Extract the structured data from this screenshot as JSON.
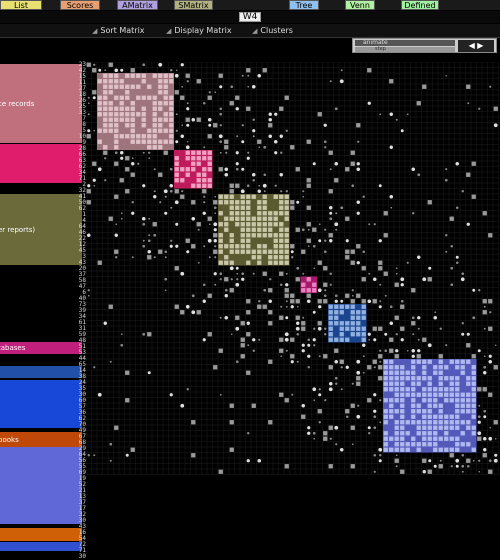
{
  "tabs": [
    {
      "label": "List",
      "color": "#e8e070"
    },
    {
      "label": "Scores",
      "color": "#e8a070"
    },
    {
      "label": "AMatrix",
      "color": "#b0a0e0"
    },
    {
      "label": "SMatrix",
      "color": "#b0b080"
    },
    {
      "label": "Tree",
      "color": "#90c0f0"
    },
    {
      "label": "Venn",
      "color": "#b0f0a0"
    },
    {
      "label": "Defined",
      "color": "#a0f0a0"
    }
  ],
  "window": {
    "title": "W4"
  },
  "menus": [
    "Sort Matrix",
    "Display Matrix",
    "Clusters"
  ],
  "animation": {
    "animate_label": "animate",
    "step_label": "step",
    "play_symbol": "◀ ▶"
  },
  "groups": [
    {
      "label": "ce records",
      "color": "#c0707c"
    },
    {
      "label": "",
      "color": "#e01c6c"
    },
    {
      "label": "er reports)",
      "color": "#6a6a3a"
    },
    {
      "label": "tabases",
      "color": "#c0207c"
    },
    {
      "label": "",
      "color": "#2050a8"
    },
    {
      "label": "",
      "color": "#1848d8"
    },
    {
      "label": "books",
      "color": "#c04808"
    },
    {
      "label": "",
      "color": "#6068d8"
    },
    {
      "label": "",
      "color": "#d06008"
    },
    {
      "label": "",
      "color": "#3050d0"
    }
  ],
  "row_numbers": [
    "23",
    "42",
    "15",
    "11",
    "27",
    "18",
    "26",
    "25",
    "33",
    "7",
    "8",
    "5",
    "10",
    "9",
    "28",
    "66",
    "63",
    "62",
    "34",
    "71",
    "2",
    "32",
    "41",
    "50",
    "62",
    "1",
    "4",
    "64",
    "46",
    "22",
    "12",
    "45",
    "3",
    "43",
    "20",
    "37",
    "58",
    "47",
    "6",
    "40",
    "73",
    "39",
    "34",
    "61",
    "31",
    "59",
    "48",
    "51",
    "53",
    "44",
    "65",
    "14",
    "38",
    "24",
    "35",
    "30",
    "60",
    "57",
    "36",
    "62",
    "70",
    "49",
    "67",
    "68",
    "29",
    "64",
    "56",
    "55",
    "69",
    "19",
    "52",
    "21",
    "13",
    "37",
    "17",
    "32",
    "30",
    "43",
    "16",
    "54",
    "72",
    "71",
    "30"
  ]
}
